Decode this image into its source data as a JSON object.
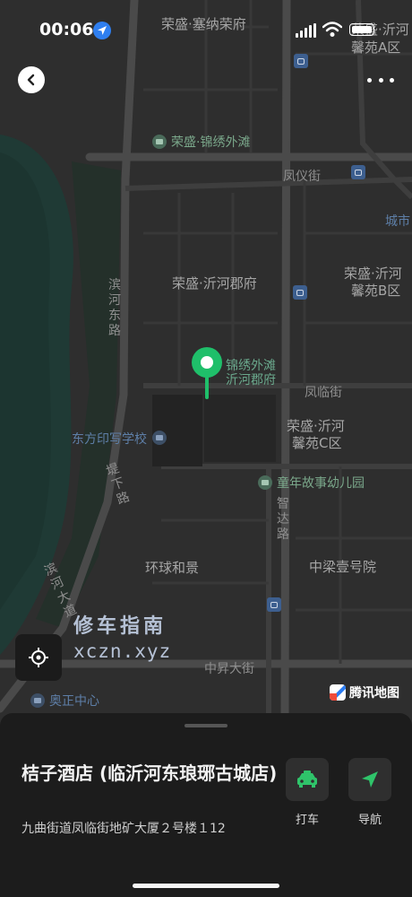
{
  "status_bar": {
    "time": "00:06"
  },
  "map": {
    "labels": {
      "saina_rongfu": "荣盛·塞纳荣府",
      "yiheyuan_a_1": "荣盛·沂河",
      "yiheyuan_a_2": "馨苑A区",
      "jinxiu_waitan": "荣盛·锦绣外滩",
      "fengyi_street": "凤仪街",
      "city": "城市",
      "yihe_junfu": "荣盛·沂河郡府",
      "yiheyuan_b_1": "荣盛·沂河",
      "yiheyuan_b_2": "馨苑B区",
      "binhe_east_road": "滨河东路",
      "fenglin_street": "凤临街",
      "yiheyuan_c_1": "荣盛·沂河",
      "yiheyuan_c_2": "馨苑C区",
      "dongfang_school": "东方印写学校",
      "tongnian_kindergarten": "童年故事幼儿园",
      "ti_road": "堤下路",
      "zhida_road": "智达路",
      "binhe_avenue": "滨河大道",
      "huanqiu_hejing": "环球和景",
      "zhongliang": "中梁壹号院",
      "zhongsheng_street": "中昇大街",
      "aozheng_center": "奥正中心"
    },
    "pin_label_line1": "锦绣外滩",
    "pin_label_line2": "沂河郡府",
    "watermark_line1": "修车指南",
    "watermark_line2": "xczn.xyz",
    "provider": "腾讯地图"
  },
  "place": {
    "name": "桔子酒店 (临沂河东琅琊古城店)",
    "address": "九曲街道凤临街地矿大厦２号楼１12"
  },
  "actions": {
    "taxi_label": "打车",
    "navigate_label": "导航"
  },
  "colors": {
    "pin": "#1fbf6a",
    "accent_green": "#2fc46a",
    "sheet_bg": "#1c1c1c"
  },
  "icons": [
    "location-arrow-icon",
    "back-icon",
    "more-icon",
    "map-pin-icon",
    "locate-icon",
    "taxi-icon",
    "navigate-icon",
    "bus-stop-icon",
    "poi-icon"
  ]
}
